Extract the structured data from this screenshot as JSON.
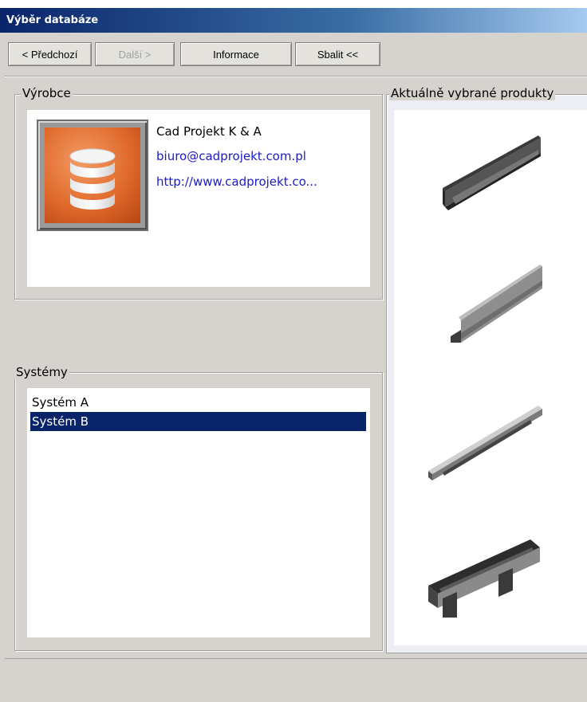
{
  "window": {
    "title": "Výběr databáze"
  },
  "toolbar": {
    "prev_label": "< Předchozí",
    "next_label": "Další >",
    "info_label": "Informace",
    "collapse_label": "Sbalit <<"
  },
  "manufacturer": {
    "group_label": "Výrobce",
    "icon": "database-icon",
    "name": "Cad Projekt K & A",
    "email": "biuro@cadprojekt.com.pl",
    "website": "http://www.cadprojekt.co..."
  },
  "systems": {
    "group_label": "Systémy",
    "items": [
      {
        "label": "Systém A",
        "selected": false
      },
      {
        "label": "Systém B",
        "selected": true
      }
    ]
  },
  "products": {
    "group_label": "Aktuálně vybrané produkty",
    "items": [
      {
        "icon": "u-channel-profile-icon"
      },
      {
        "icon": "l-angle-profile-icon"
      },
      {
        "icon": "flat-channel-profile-icon"
      },
      {
        "icon": "double-channel-profile-icon"
      }
    ]
  },
  "colors": {
    "title_gradient_start": "#0a246a",
    "title_gradient_end": "#a6caf0",
    "selection": "#0a246a",
    "link": "#1a1acc",
    "icon_orange": "#e06a2c"
  }
}
